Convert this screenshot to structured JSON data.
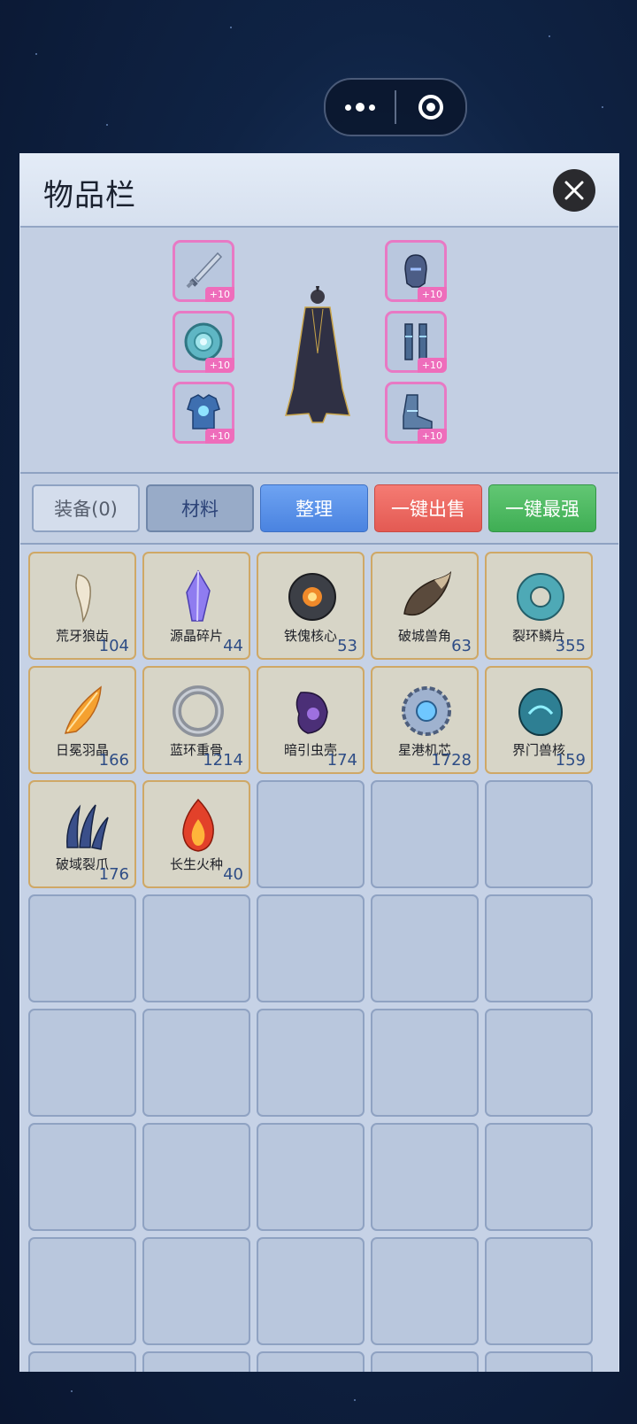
{
  "window": {
    "title": "物品栏"
  },
  "equipment": {
    "left": [
      {
        "icon": "sword-icon",
        "level": "+10"
      },
      {
        "icon": "orb-ring-icon",
        "level": "+10"
      },
      {
        "icon": "armor-icon",
        "level": "+10"
      }
    ],
    "right": [
      {
        "icon": "helmet-icon",
        "level": "+10"
      },
      {
        "icon": "greaves-icon",
        "level": "+10"
      },
      {
        "icon": "boots-icon",
        "level": "+10"
      }
    ]
  },
  "tabs": {
    "equip": "装备(0)",
    "materials": "材料",
    "sort": "整理",
    "sell_all": "一键出售",
    "best": "一键最强"
  },
  "items": [
    {
      "name": "荒牙狼齿",
      "count": "104",
      "icon": "fang-icon"
    },
    {
      "name": "源晶碎片",
      "count": "44",
      "icon": "crystal-icon"
    },
    {
      "name": "铁傀核心",
      "count": "53",
      "icon": "iron-core-icon"
    },
    {
      "name": "破城兽角",
      "count": "63",
      "icon": "horn-icon"
    },
    {
      "name": "裂环鳞片",
      "count": "355",
      "icon": "scale-ring-icon"
    },
    {
      "name": "日冕羽晶",
      "count": "166",
      "icon": "feather-icon"
    },
    {
      "name": "蓝环重骨",
      "count": "1214",
      "icon": "bone-ring-icon"
    },
    {
      "name": "暗引虫壳",
      "count": "174",
      "icon": "shell-icon"
    },
    {
      "name": "星港机芯",
      "count": "1728",
      "icon": "gear-core-icon"
    },
    {
      "name": "界门兽核",
      "count": "159",
      "icon": "beast-core-icon"
    },
    {
      "name": "破域裂爪",
      "count": "176",
      "icon": "claw-icon"
    },
    {
      "name": "长生火种",
      "count": "40",
      "icon": "flame-icon"
    }
  ],
  "colors": {
    "slot_border": "#e879c4",
    "item_border": "#cfa866",
    "count_text": "#2e4d86"
  }
}
